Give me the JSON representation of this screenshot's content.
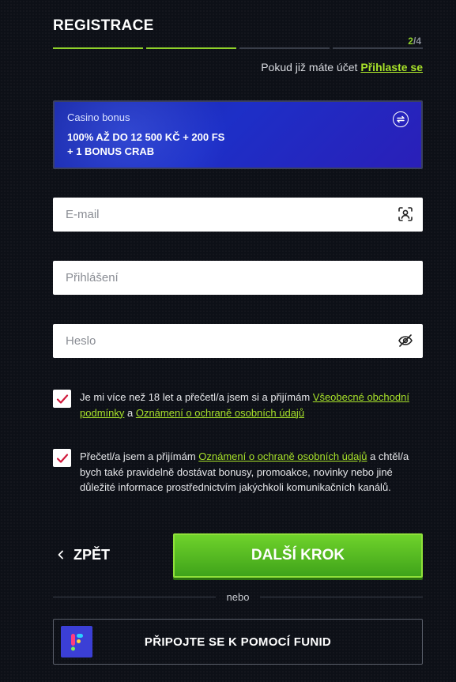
{
  "header": {
    "title": "REGISTRACE",
    "step_current": "2",
    "step_total": "/4",
    "progress_steps_done": 2,
    "progress_steps_total": 4
  },
  "login_prompt": {
    "text": "Pokud již máte účet",
    "link": "Přihlaste se"
  },
  "bonus": {
    "label": "Casino bonus",
    "line1": "100% AŽ DO 12 500 KČ + 200 FS",
    "line2": "+ 1 BONUS CRAB",
    "swap_icon": "swap-icon"
  },
  "fields": {
    "email_placeholder": "E-mail",
    "username_placeholder": "Přihlášení",
    "password_placeholder": "Heslo"
  },
  "consents": {
    "terms": {
      "checked": true,
      "text_before": "Je mi více než 18 let a přečetl/a jsem si a přijímám ",
      "link1": "Všeobecné obchodní podmínky",
      "text_mid": " a ",
      "link2": "Oznámení o ochraně osobních údajů"
    },
    "marketing": {
      "checked": true,
      "text_before": "Přečetl/a jsem a přijímám ",
      "link": "Oznámení o ochraně osobních údajů",
      "text_after": " a chtěl/a bych také pravidelně dostávat bonusy, promoakce, novinky nebo jiné důležité informace prostřednictvím jakýchkoli komunikačních kanálů."
    }
  },
  "actions": {
    "back_label": "ZPĚT",
    "next_label": "DALŠÍ KROK",
    "or_label": "nebo",
    "funid_label": "PŘIPOJTE SE K POMOCÍ FUNID"
  },
  "colors": {
    "accent": "#a8e22a",
    "bonus_blue": "#1d2fc7",
    "next_green": "#4fb81f",
    "background": "#0d1017"
  }
}
